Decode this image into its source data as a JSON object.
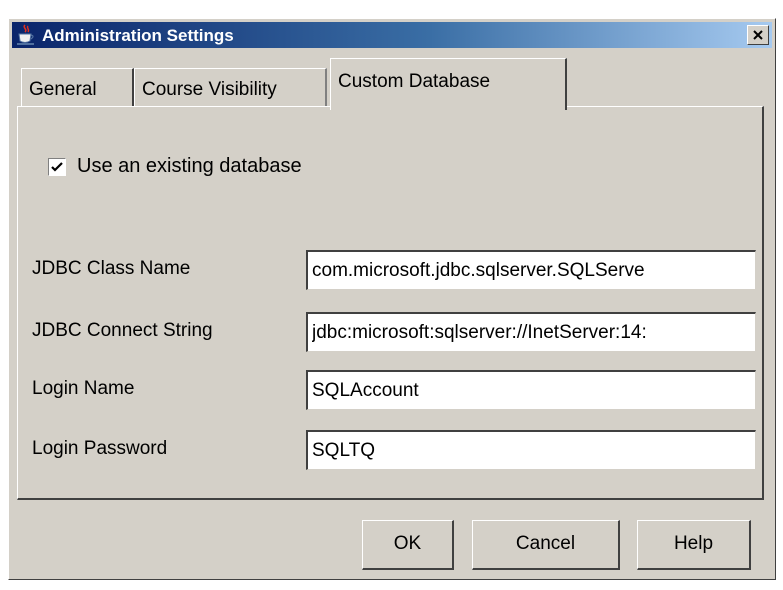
{
  "window": {
    "title": "Administration Settings",
    "app_icon": "java-cup-icon",
    "close_icon": "close-icon",
    "titlebar_colors": [
      "#0a246a",
      "#3a6ea5",
      "#a6caf0"
    ],
    "background": "#d4d0c8"
  },
  "tabs": [
    {
      "label": "General",
      "selected": false
    },
    {
      "label": "Course Visibility",
      "selected": false
    },
    {
      "label": "Custom Database",
      "selected": true
    }
  ],
  "custom_database": {
    "use_existing": {
      "label": "Use an existing database",
      "checked": true
    },
    "fields": [
      {
        "label": "JDBC Class Name",
        "value": "com.microsoft.jdbc.sqlserver.SQLServe"
      },
      {
        "label": "JDBC Connect String",
        "value": "jdbc:microsoft:sqlserver://InetServer:14:"
      },
      {
        "label": "Login Name",
        "value": "SQLAccount"
      },
      {
        "label": "Login Password",
        "value": "SQLTQ"
      }
    ]
  },
  "buttons": {
    "ok": "OK",
    "cancel": "Cancel",
    "help": "Help"
  }
}
